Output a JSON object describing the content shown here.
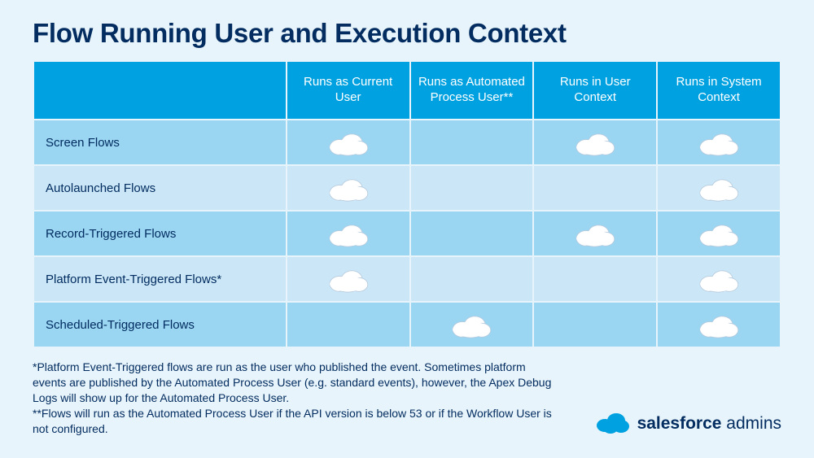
{
  "title": "Flow Running User and Execution Context",
  "columns": [
    "",
    "Runs as Current User",
    "Runs as Automated Process User**",
    "Runs in User Context",
    "Runs in System Context"
  ],
  "chart_data": {
    "type": "table",
    "title": "Flow Running User and Execution Context",
    "columns": [
      "Runs as Current User",
      "Runs as Automated Process User**",
      "Runs in User Context",
      "Runs in System Context"
    ],
    "rows": [
      {
        "label": "Screen Flows",
        "values": [
          true,
          false,
          true,
          true
        ]
      },
      {
        "label": "Autolaunched Flows",
        "values": [
          true,
          false,
          false,
          true
        ]
      },
      {
        "label": "Record-Triggered Flows",
        "values": [
          true,
          false,
          true,
          true
        ]
      },
      {
        "label": "Platform Event-Triggered Flows*",
        "values": [
          true,
          false,
          false,
          true
        ]
      },
      {
        "label": "Scheduled-Triggered Flows",
        "values": [
          false,
          true,
          false,
          true
        ]
      }
    ]
  },
  "footnote1": "*Platform Event-Triggered flows are run as the user who published the event. Sometimes platform events are published by the Automated Process User (e.g. standard events), however, the Apex Debug Logs will show up for the Automated Process User.",
  "footnote2": "**Flows will run as the Automated Process User if the API version is below 53 or if the Workflow User is not configured.",
  "brand_strong": "salesforce",
  "brand_light": " admins"
}
